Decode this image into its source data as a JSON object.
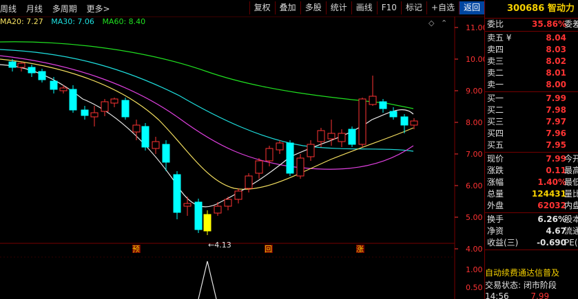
{
  "toolbar": {
    "left": [
      "周线",
      "月线",
      "多周期",
      "更多>"
    ],
    "buttons": [
      "复权",
      "叠加",
      "多股",
      "统计",
      "画线",
      "F10",
      "标记",
      "+自选",
      "返回"
    ]
  },
  "legend": {
    "ma20": "MA20: 7.27",
    "ma30": "MA30: 7.06",
    "ma60": "MA60: 8.40",
    "ma20_color": "#f5e060",
    "ma30_color": "#1ee0e0",
    "ma60_color": "#20e020"
  },
  "controls": {
    "settings_icon": "◇",
    "expand_icon": "⌃"
  },
  "price_axis": [
    "11.00",
    "10.00",
    "9.00",
    "8.00",
    "7.00",
    "6.00",
    "5.00",
    "4.00"
  ],
  "sub_axis": [
    "1.00",
    "0.50"
  ],
  "chart_data": {
    "type": "candlestick",
    "low_annotation": "←4.13",
    "markers": [
      "预",
      "回",
      "涨"
    ],
    "ylim": [
      3.7,
      11.2
    ]
  },
  "quote": {
    "code": "300686",
    "name": "智动力",
    "weibi": {
      "label": "委比",
      "value": "35.86%",
      "tail": "委差"
    },
    "asks": [
      {
        "label": "卖五 ¥",
        "price": "8.04"
      },
      {
        "label": "卖四",
        "price": "8.03"
      },
      {
        "label": "卖三",
        "price": "8.02"
      },
      {
        "label": "卖二",
        "price": "8.01"
      },
      {
        "label": "卖一",
        "price": "8.00"
      }
    ],
    "bids": [
      {
        "label": "买一",
        "price": "7.99"
      },
      {
        "label": "买二",
        "price": "7.98"
      },
      {
        "label": "买三",
        "price": "7.97"
      },
      {
        "label": "买四",
        "price": "7.96"
      },
      {
        "label": "买五",
        "price": "7.95"
      }
    ],
    "stats": [
      {
        "label": "现价",
        "value": "7.99",
        "tail": "今开",
        "c": "red"
      },
      {
        "label": "涨跌",
        "value": "0.11",
        "tail": "最高",
        "c": "red"
      },
      {
        "label": "涨幅",
        "value": "1.40%",
        "tail": "最低",
        "c": "red"
      },
      {
        "label": "总量",
        "value": "124431",
        "tail": "量比",
        "c": "yellow"
      },
      {
        "label": "外盘",
        "value": "62032",
        "tail": "内盘",
        "c": "red"
      }
    ],
    "stats2": [
      {
        "label": "换手",
        "value": "6.26%",
        "tail": "股本",
        "c": "white"
      },
      {
        "label": "净资",
        "value": "4.67",
        "tail": "流通",
        "c": "white"
      },
      {
        "label": "收益(三)",
        "value": "-0.690",
        "tail": "PE(动",
        "c": "white"
      }
    ],
    "banner1": "自动续费通达信普及",
    "banner2": "交易状态: 闭市阶段",
    "bottom_time": "14:56",
    "bottom_price": "7.99"
  }
}
